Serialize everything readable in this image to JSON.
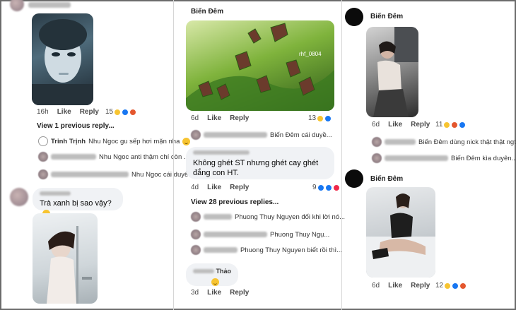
{
  "col1": {
    "comment1": {
      "time": "16h",
      "like": "Like",
      "reply": "Reply",
      "react_count": "15"
    },
    "view_prev": "View 1 previous reply...",
    "replies": [
      {
        "name": "Trinh Trịnh",
        "text": "Nhu Ngoc gu sếp hơi mặn nha"
      },
      {
        "name": "",
        "text": "Nhu Ngoc anti thậm chí còn ..."
      },
      {
        "name": "",
        "text": "Nhu Ngoc cái duyê..."
      }
    ],
    "comment2": {
      "text": "Trà xanh bị sao vậy?"
    }
  },
  "col2": {
    "author": "Biến Đêm",
    "photo_caption": "rhf_0804",
    "comment1": {
      "time": "6d",
      "like": "Like",
      "reply": "Reply",
      "react_count": "13"
    },
    "reply_row": {
      "text": "Biến Đêm cái duyề..."
    },
    "comment2": {
      "text": "Không ghét ST nhưng ghét cay ghét đắng con HT.",
      "time": "4d",
      "like": "Like",
      "reply": "Reply",
      "react_count": "9"
    },
    "view_prev": "View 28 previous replies...",
    "replies": [
      {
        "text": "Phuong Thuy Nguyen  đối khi lời nó..."
      },
      {
        "text": "Phuong Thuy Ngụ..."
      },
      {
        "text": "Phuong Thuy Nguyen biết rồi thì..."
      }
    ],
    "comment3": {
      "name": "Thảo",
      "time": "3d",
      "like": "Like",
      "reply": "Reply"
    }
  },
  "col3": {
    "post1": {
      "author": "Biến Đêm",
      "time": "6d",
      "like": "Like",
      "reply": "Reply",
      "react_count": "11"
    },
    "replies": [
      {
        "text": "Biến Đêm  dùng nick thật thật ngta..."
      },
      {
        "text": "Biến Đêm kìa duyên..."
      }
    ],
    "post2": {
      "author": "Biến Đêm",
      "time": "6d",
      "like": "Like",
      "reply": "Reply",
      "react_count": "12"
    }
  },
  "colors": {
    "link": "#1877f2",
    "bubble": "#f0f2f5",
    "muted": "#65676b"
  }
}
